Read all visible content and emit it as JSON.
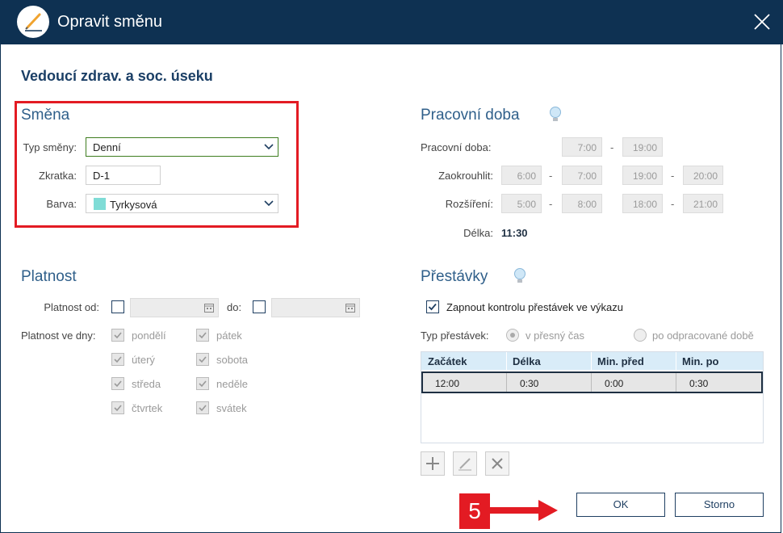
{
  "window": {
    "title": "Opravit směnu"
  },
  "page_heading": "Vedoucí zdrav. a soc. úseku",
  "smena": {
    "title": "Směna",
    "type_label": "Typ směny:",
    "type_value": "Denní",
    "abbr_label": "Zkratka:",
    "abbr_value": "D-1",
    "color_label": "Barva:",
    "color_value": "Tyrkysová",
    "color_swatch": "#7fdcd6"
  },
  "pracovni_doba": {
    "title": "Pracovní doba",
    "work_label": "Pracovní doba:",
    "work_from": "7:00",
    "work_to": "19:00",
    "round_label": "Zaokrouhlit:",
    "round": [
      "6:00",
      "7:00",
      "19:00",
      "20:00"
    ],
    "ext_label": "Rozšíření:",
    "ext": [
      "5:00",
      "8:00",
      "18:00",
      "21:00"
    ],
    "length_label": "Délka:",
    "length_value": "11:30",
    "dash": "-"
  },
  "platnost": {
    "title": "Platnost",
    "from_label": "Platnost od:",
    "to_label": "do:",
    "days_label": "Platnost ve dny:",
    "days": [
      "pondělí",
      "úterý",
      "středa",
      "čtvrtek",
      "pátek",
      "sobota",
      "neděle",
      "svátek"
    ]
  },
  "prestavky": {
    "title": "Přestávky",
    "enable_label": "Zapnout kontrolu přestávek ve výkazu",
    "type_label": "Typ přestávek:",
    "type_option1": "v přesný čas",
    "type_option2": "po odpracované době",
    "columns": [
      "Začátek",
      "Délka",
      "Min. před",
      "Min. po"
    ],
    "rows": [
      [
        "12:00",
        "0:30",
        "0:00",
        "0:30"
      ]
    ]
  },
  "buttons": {
    "ok": "OK",
    "cancel": "Storno"
  },
  "annotation": {
    "step": "5"
  }
}
